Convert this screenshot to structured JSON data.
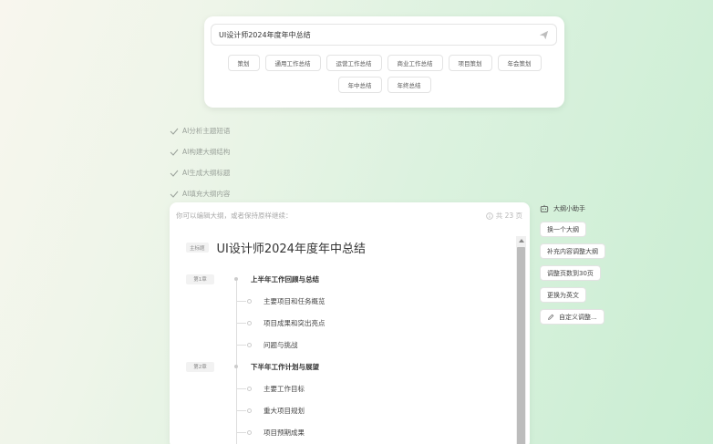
{
  "prompt": {
    "value": "UI设计师2024年度年中总结"
  },
  "chips": [
    "策划",
    "通用工作总结",
    "运营工作总结",
    "商业工作总结",
    "项目策划",
    "年会策划",
    "年中总结",
    "年终总结"
  ],
  "steps": [
    "AI分析主题短语",
    "AI构建大纲结构",
    "AI生成大纲标题",
    "AI填充大纲内容"
  ],
  "outline": {
    "hint": "你可以编辑大纲，或者保持原样继续：",
    "pages": "共 23 页",
    "title_tag": "主标题",
    "title": "UI设计师2024年度年中总结",
    "chapters": [
      {
        "tag": "第1章",
        "title": "上半年工作回顾与总结",
        "items": [
          "主要项目和任务概览",
          "项目成果和突出亮点",
          "问题与挑战"
        ]
      },
      {
        "tag": "第2章",
        "title": "下半年工作计划与展望",
        "items": [
          "主要工作目标",
          "重大项目规划",
          "项目预期成果"
        ]
      }
    ]
  },
  "assistant": {
    "title": "大纲小助手",
    "buttons": [
      "换一个大纲",
      "补充内容调整大纲",
      "调整页数到30页",
      "更换为英文"
    ],
    "custom": "自定义调整..."
  }
}
